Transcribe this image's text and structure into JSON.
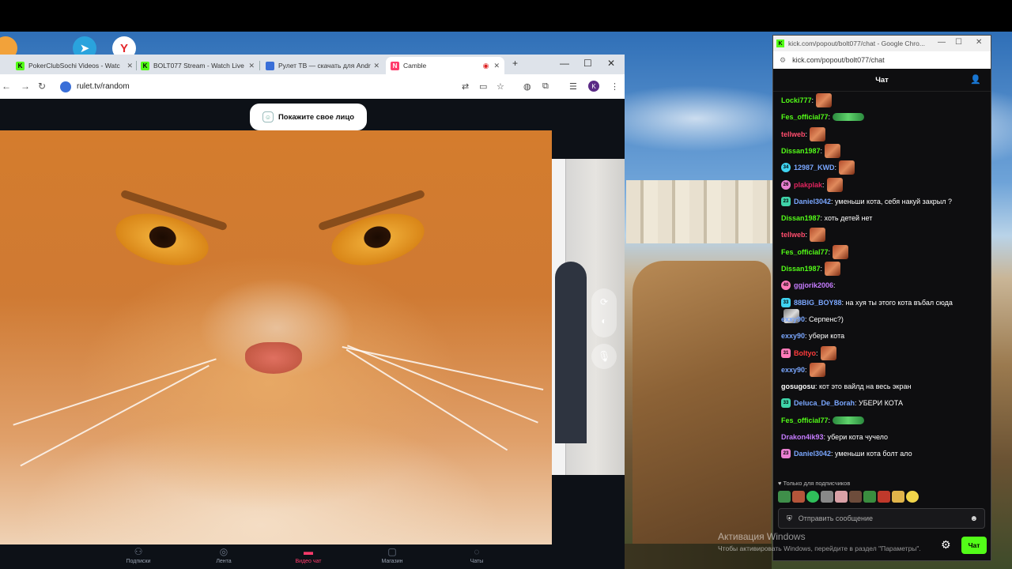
{
  "desktop": {
    "icons": [
      "telegram-icon",
      "yandex-browser-icon"
    ],
    "activation": {
      "title": "Активация Windows",
      "subtitle": "Чтобы активировать Windows, перейдите в раздел \"Параметры\"."
    }
  },
  "browser": {
    "tabs": [
      {
        "label": "PokerClubSochi Videos - Watc",
        "icon": "kick-icon"
      },
      {
        "label": "BOLT077 Stream - Watch Live",
        "icon": "kick-icon"
      },
      {
        "label": "Рулет ТВ — скачать для Andr",
        "icon": "app-icon"
      },
      {
        "label": "Camble",
        "icon": "camble-icon",
        "active": true
      }
    ],
    "new_tab": "+",
    "url": "rulet.tv/random",
    "profile_letter": "K"
  },
  "page": {
    "show_face_label": "Покажите свое лицо",
    "nav": [
      {
        "label": "Подписки",
        "icon": "subscriptions-icon"
      },
      {
        "label": "Лента",
        "icon": "feed-icon"
      },
      {
        "label": "Видео чат",
        "icon": "video-chat-icon",
        "active": true
      },
      {
        "label": "Магазин",
        "icon": "shop-icon"
      },
      {
        "label": "Чаты",
        "icon": "chats-icon"
      }
    ]
  },
  "chat_window": {
    "title": "kick.com/popout/bolt077/chat - Google Chro...",
    "url": "kick.com/popout/bolt077/chat",
    "header": "Чат",
    "colors": {
      "accent": "#53fc18"
    },
    "messages": [
      {
        "user": "Locki777",
        "color": "#53fc18",
        "badge": "",
        "text": ":",
        "emote": "face"
      },
      {
        "user": "Fes_official77",
        "color": "#53fc18",
        "badge": "",
        "text": ":",
        "emote": "frog"
      },
      {
        "user": "tellweb",
        "color": "#ff4d6d",
        "badge": "",
        "text": ":",
        "emote": "face"
      },
      {
        "user": "Dissan1987",
        "color": "#53fc18",
        "badge": "",
        "text": ":",
        "emote": "face"
      },
      {
        "user": "12987_KWD",
        "color": "#7aa7ff",
        "badge": "34",
        "text": ":",
        "emote": "face"
      },
      {
        "user": "plakplak",
        "color": "#e0245e",
        "badge": "26",
        "text": ":",
        "emote": "face"
      },
      {
        "user": "Daniel3042",
        "color": "#7aa7ff",
        "badge": "23",
        "text": ": уменьши кота, себя накуй закрыл ?",
        "emote": ""
      },
      {
        "user": "Dissan1987",
        "color": "#53fc18",
        "badge": "",
        "text": ": хоть детей нет",
        "emote": ""
      },
      {
        "user": "tellweb",
        "color": "#ff4d6d",
        "badge": "",
        "text": ":",
        "emote": "face"
      },
      {
        "user": "Fes_official77",
        "color": "#53fc18",
        "badge": "",
        "text": ":",
        "emote": "face"
      },
      {
        "user": "Dissan1987",
        "color": "#53fc18",
        "badge": "",
        "text": ":",
        "emote": "face"
      },
      {
        "user": "ggjorik2006",
        "color": "#c67cff",
        "badge": "40",
        "text": ":",
        "emote": "cat"
      },
      {
        "user": "88BIG_BOY88",
        "color": "#7aa7ff",
        "badge": "33",
        "text": ": на хуя ты этого кота въбал сюда",
        "emote": ""
      },
      {
        "user": "exxy90",
        "color": "#7aa7ff",
        "badge": "",
        "text": ": Серпенс?)",
        "emote": ""
      },
      {
        "user": "exxy90",
        "color": "#7aa7ff",
        "badge": "",
        "text": ": убери кота",
        "emote": ""
      },
      {
        "user": "Boltyo",
        "color": "#ff3b3b",
        "badge": "31",
        "text": ":",
        "emote": "face"
      },
      {
        "user": "exxy90",
        "color": "#7aa7ff",
        "badge": "",
        "text": ":",
        "emote": "face"
      },
      {
        "user": "gosugosu",
        "color": "#ffffff",
        "badge": "",
        "text": ": кот это вайлд на весь экран",
        "emote": ""
      },
      {
        "user": "Deluca_De_Borah",
        "color": "#7aa7ff",
        "badge": "33",
        "text": ": УБЕРИ КОТА",
        "emote": ""
      },
      {
        "user": "Fes_official77",
        "color": "#53fc18",
        "badge": "",
        "text": ":",
        "emote": "frog"
      },
      {
        "user": "Drakon4ik93",
        "color": "#c67cff",
        "badge": "",
        "text": ": убери кота чучело",
        "emote": ""
      },
      {
        "user": "Daniel3042",
        "color": "#7aa7ff",
        "badge": "23",
        "text": ": уменьши кота болт ало",
        "emote": ""
      }
    ],
    "subscribers_only": "Только для подписчиков",
    "input_placeholder": "Отправить сообщение",
    "send_label": "Чат"
  }
}
